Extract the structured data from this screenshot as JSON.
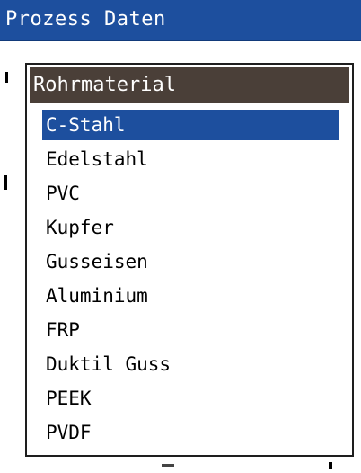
{
  "window": {
    "title": "Prozess Daten"
  },
  "dropdown": {
    "title": "Rohrmaterial",
    "selected_index": 0,
    "options": [
      "C-Stahl",
      "Edelstahl",
      "PVC",
      "Kupfer",
      "Gusseisen",
      "Aluminium",
      "FRP",
      "Duktil Guss",
      "PEEK",
      "PVDF"
    ]
  },
  "colors": {
    "title_bar": "#1d4f9e",
    "popup_header": "#4a3f38",
    "selection": "#1d4f9e"
  }
}
